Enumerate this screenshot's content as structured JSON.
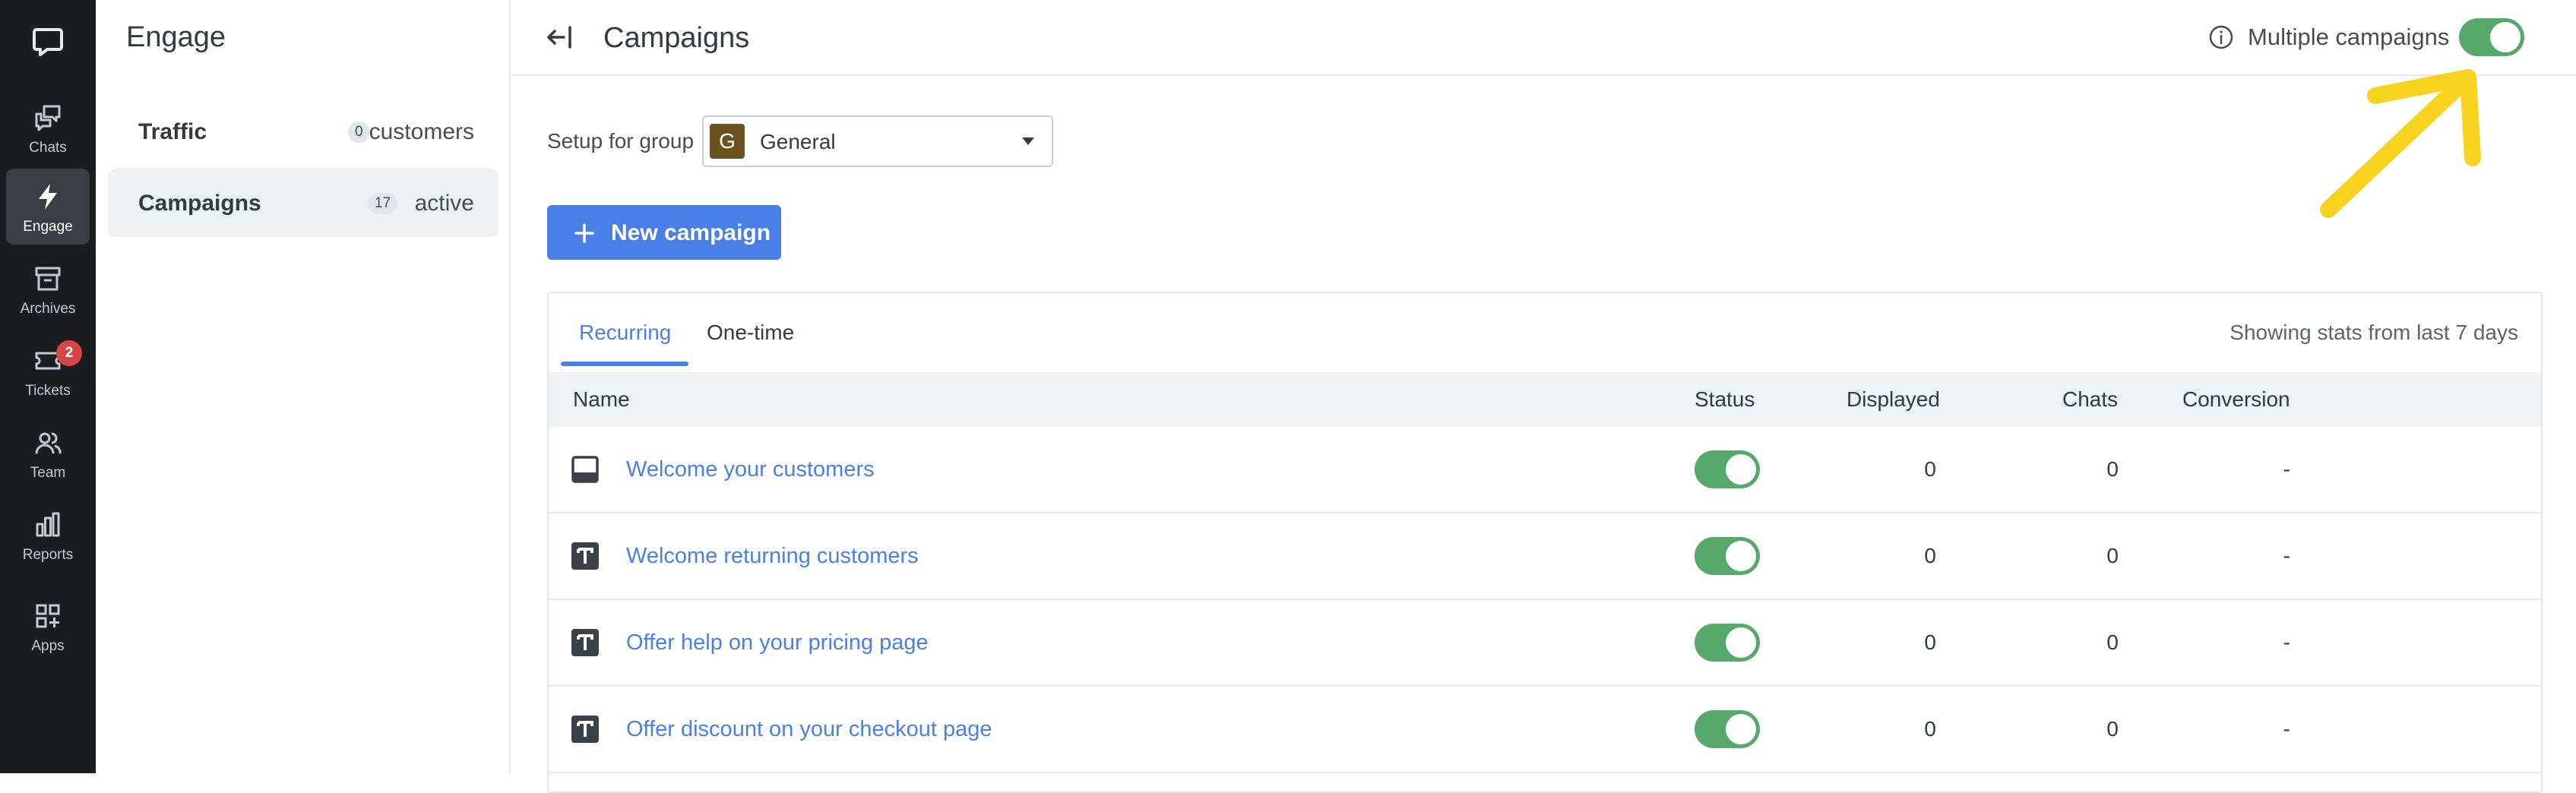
{
  "rail": {
    "items": [
      {
        "label": "Chats",
        "icon": "chats-icon"
      },
      {
        "label": "Engage",
        "icon": "lightning-icon",
        "active": true
      },
      {
        "label": "Archives",
        "icon": "archive-icon"
      },
      {
        "label": "Tickets",
        "icon": "ticket-icon",
        "badge": "2"
      },
      {
        "label": "Team",
        "icon": "team-icon"
      },
      {
        "label": "Reports",
        "icon": "reports-icon"
      },
      {
        "label": "Apps",
        "icon": "apps-icon"
      }
    ]
  },
  "sidebar": {
    "title": "Engage",
    "items": [
      {
        "label": "Traffic",
        "count": "0",
        "suffix": "customers"
      },
      {
        "label": "Campaigns",
        "count": "17",
        "suffix": "active",
        "active": true
      }
    ]
  },
  "header": {
    "title": "Campaigns",
    "multiple_campaigns_label": "Multiple campaigns",
    "multiple_campaigns_on": true
  },
  "setup": {
    "label": "Setup for group",
    "group_initial": "G",
    "group_name": "General"
  },
  "new_campaign_label": "New campaign",
  "tabs": [
    {
      "label": "Recurring",
      "active": true
    },
    {
      "label": "One-time",
      "active": false
    }
  ],
  "stats_note": "Showing stats from last 7 days",
  "table": {
    "columns": [
      "Name",
      "Status",
      "Displayed",
      "Chats",
      "Conversion"
    ],
    "rows": [
      {
        "name": "Welcome your customers",
        "type_icon": "bar-campaign-icon",
        "status_on": true,
        "displayed": "0",
        "chats": "0",
        "conversion": "-"
      },
      {
        "name": "Welcome returning customers",
        "type_icon": "text-campaign-icon",
        "status_on": true,
        "displayed": "0",
        "chats": "0",
        "conversion": "-"
      },
      {
        "name": "Offer help on your pricing page",
        "type_icon": "text-campaign-icon",
        "status_on": true,
        "displayed": "0",
        "chats": "0",
        "conversion": "-"
      },
      {
        "name": "Offer discount on your checkout page",
        "type_icon": "text-campaign-icon",
        "status_on": true,
        "displayed": "0",
        "chats": "0",
        "conversion": "-"
      }
    ]
  },
  "colors": {
    "accent": "#4a7fe8",
    "toggle_on": "#56a96a",
    "annotation_arrow": "#f7d21e",
    "badge": "#d64646"
  }
}
